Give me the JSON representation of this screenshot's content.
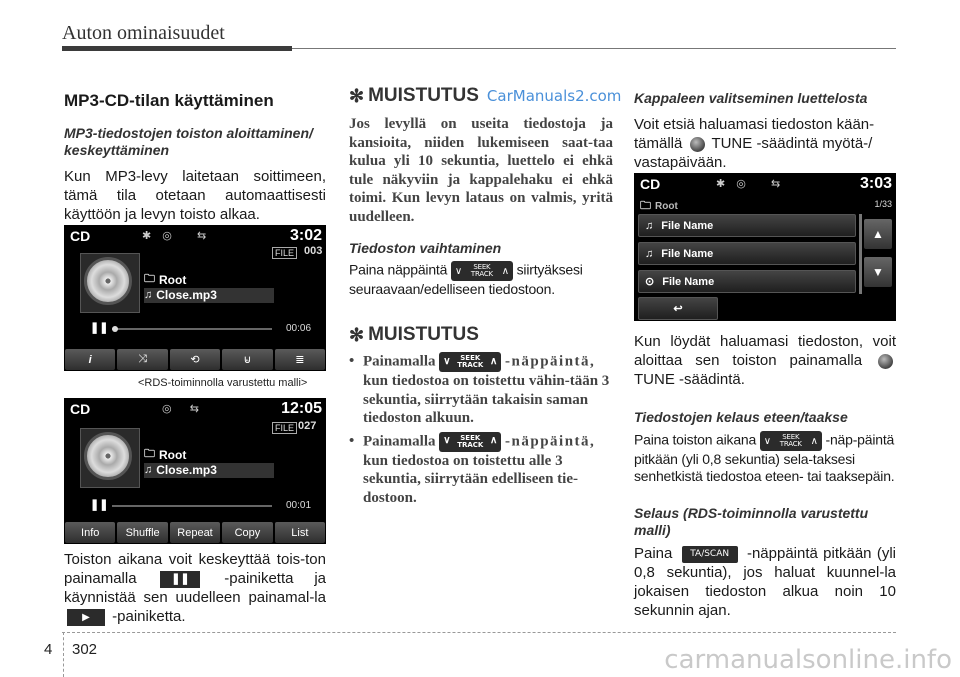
{
  "header": {
    "title": "Auton ominaisuudet"
  },
  "col1": {
    "heading": "MP3-CD-tilan käyttäminen",
    "subheading": "MP3-tiedostojen toiston aloittaminen/ keskeyttäminen",
    "intro": "Kun MP3-levy laitetaan soittimeen, tämä tila otetaan automaattisesti käyttöön ja levyn toisto alkaa.",
    "screen1": {
      "mode": "CD",
      "time": "3:02",
      "file_label": "FILE",
      "file_num": "003",
      "folder": "Root",
      "track": "Close.mp3",
      "elapsed": "00:06",
      "buttons": [
        "i",
        "⤨",
        "⟲",
        "⊌",
        "≣"
      ]
    },
    "caption1": "<RDS-toiminnolla varustettu malli>",
    "screen2": {
      "mode": "CD",
      "time": "12:05",
      "file_label": "FILE",
      "file_num": "027",
      "folder": "Root",
      "track": "Close.mp3",
      "elapsed": "00:01",
      "buttons": [
        "Info",
        "Shuffle",
        "Repeat",
        "Copy",
        "List"
      ]
    },
    "pause_text_1": "Toiston aikana voit keskeyttää tois-ton painamalla",
    "pause_text_2": "-painiketta ja käynnistää sen uudelleen painamal-la",
    "pause_text_3": "-painiketta."
  },
  "col2": {
    "note1_title": "MUISTUTUS",
    "watermark": "CarManuals2.com",
    "note1_body": "Jos levyllä on useita tiedostoja ja kansioita, niiden lukemiseen saat-taa kulua yli 10 sekuntia, luettelo ei ehkä tule näkyviin ja kappalehaku ei ehkä toimi. Kun levyn lataus on valmis, yritä uudelleen.",
    "sub2": "Tiedoston vaihtaminen",
    "change_text_1": "Paina näppäintä",
    "change_text_2": "siirtyäksesi seuraavaan/edelliseen tiedostoon.",
    "note2_title": "MUISTUTUS",
    "bullet1_a": "Painamalla",
    "bullet1_b": "-näppäintä,",
    "bullet1_c": "kun tiedostoa on toistettu vähin-tään 3 sekuntia, siirrytään takaisin saman tiedoston alkuun.",
    "bullet2_a": "Painamalla",
    "bullet2_b": "-näppäintä,",
    "bullet2_c": "kun tiedostoa on toistettu alle 3 sekuntia, siirrytään edelliseen tie-dostoon.",
    "seek_label_1": "SEEK",
    "seek_label_2": "TRACK"
  },
  "col3": {
    "sub1": "Kappaleen valitseminen luettelosta",
    "select_text_1": "Voit etsiä haluamasi tiedoston kään-tämällä",
    "select_text_2": "TUNE -säädintä myötä-/ vastapäivään.",
    "screen3": {
      "mode": "CD",
      "time": "3:03",
      "folder": "Root",
      "page": "1/33",
      "files": [
        "File Name",
        "File Name",
        "File Name"
      ]
    },
    "found_text_1": "Kun löydät haluamasi tiedoston, voit aloittaa sen toiston painamalla",
    "found_text_2": "TUNE -säädintä.",
    "sub2": "Tiedostojen kelaus eteen/taakse",
    "ff_text_1": "Paina toiston aikana",
    "ff_text_2": "-näp-päintä pitkään (yli 0,8 sekuntia) sela-taksesi senhetkistä tiedostoa eteen- tai taaksepäin.",
    "sub3": "Selaus (RDS-toiminnolla varustettu malli)",
    "scan_text_1": "Paina",
    "scan_label": "TA/SCAN",
    "scan_text_2": "-näppäintä pitkään (yli 0,8 sekuntia), jos haluat kuunnel-la jokaisen tiedoston alkua noin 10 sekunnin ajan."
  },
  "footer": {
    "chapter": "4",
    "page": "302",
    "watermark": "carmanualsonline.info"
  }
}
